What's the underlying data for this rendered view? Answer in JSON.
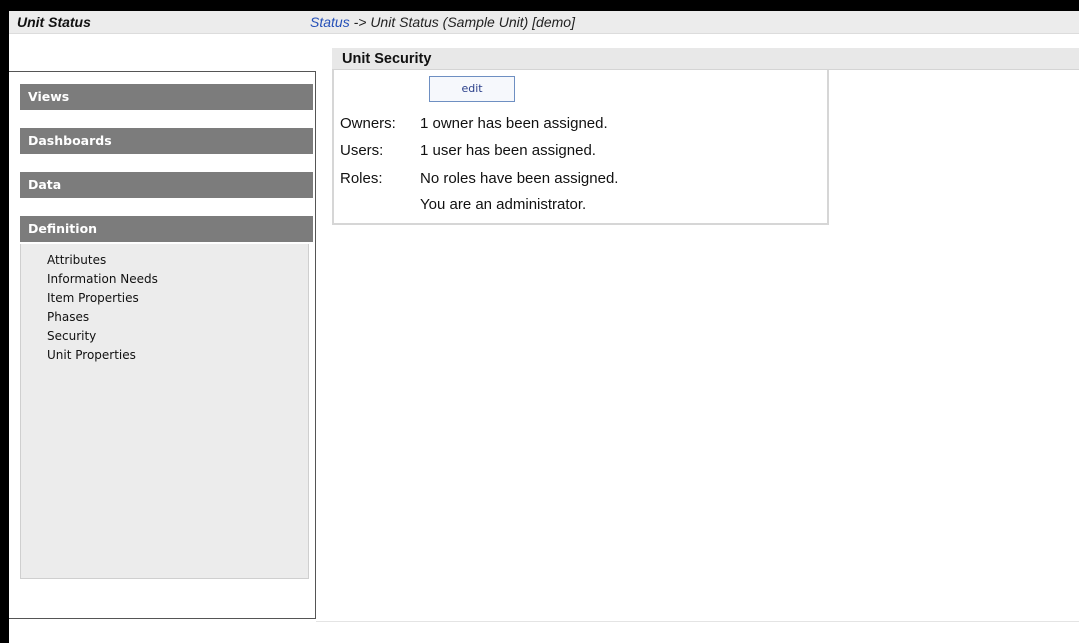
{
  "header": {
    "app_title": "Unit Status",
    "breadcrumb_link": "Status",
    "breadcrumb_rest": " -> Unit Status (Sample Unit) [demo]"
  },
  "sidebar": {
    "sections": [
      "Views",
      "Dashboards",
      "Data",
      "Definition"
    ],
    "definition_items": [
      "Attributes",
      "Information Needs",
      "Item Properties",
      "Phases",
      "Security",
      "Unit Properties"
    ]
  },
  "main": {
    "title": "Unit Security",
    "edit_label": "edit",
    "rows": [
      {
        "label": "Owners:",
        "value": "1 owner has been assigned."
      },
      {
        "label": "Users:",
        "value": "1 user has been assigned."
      },
      {
        "label": "Roles:",
        "value": "No roles have been assigned."
      },
      {
        "label": "",
        "value": "You are an administrator."
      }
    ]
  }
}
